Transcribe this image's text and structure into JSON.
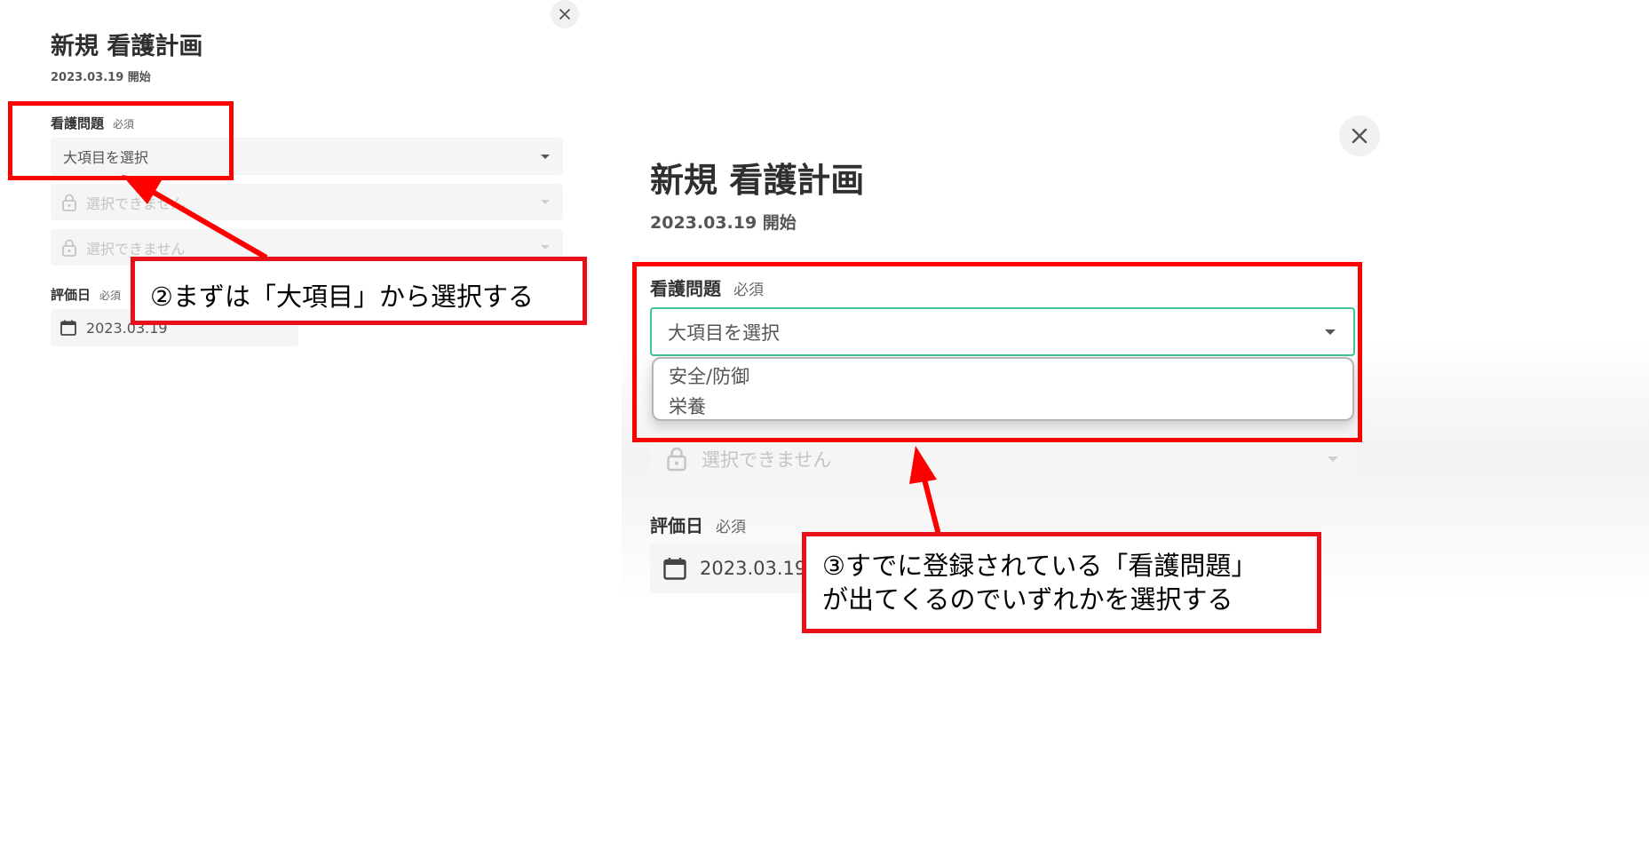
{
  "left_panel": {
    "title": "新規 看護計画",
    "start_date": "2023.03.19 開始",
    "problem_label": "看護問題",
    "required": "必須",
    "category_select": "大項目を選択",
    "disabled_1": "選択できません",
    "disabled_2": "選択できません",
    "eval_label": "評価日",
    "eval_required": "必須",
    "eval_date": "2023.03.19"
  },
  "right_panel": {
    "title": "新規 看護計画",
    "start_date": "2023.03.19 開始",
    "problem_label": "看護問題",
    "required": "必須",
    "category_select": "大項目を選択",
    "options": [
      "安全/防御",
      "栄養"
    ],
    "disabled_1": "選択できません",
    "eval_label": "評価日",
    "eval_required": "必須",
    "eval_date": "2023.03.19"
  },
  "annotations": {
    "callout_2": "②まずは「大項目」から選択する",
    "callout_3_line1": "③すでに登録されている「看護問題」",
    "callout_3_line2": "が出てくるのでいずれかを選択する"
  },
  "icons": {
    "close": "close-icon",
    "lock": "lock-icon",
    "calendar": "calendar-icon",
    "caret": "caret-down-icon"
  },
  "colors": {
    "annotation_red": "#ff0000",
    "focus_green": "#3cc49a",
    "field_bg": "#f5f5f5"
  }
}
